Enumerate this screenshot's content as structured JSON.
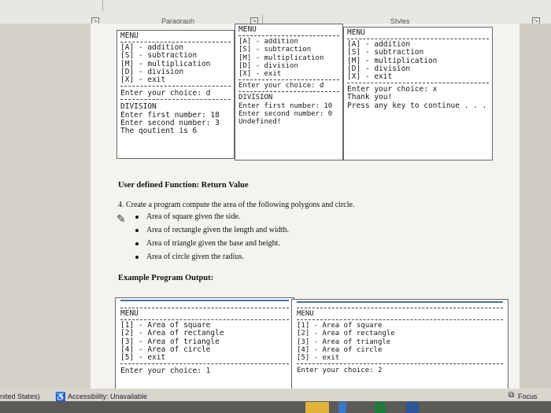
{
  "ribbon": {
    "groups": [
      {
        "label": "Paragraph"
      },
      {
        "label": "Styles"
      }
    ]
  },
  "console1": {
    "menu_title": "MENU",
    "items": [
      "[A] - addition",
      "[S] - subtraction",
      "[M] - multiplication",
      "[D] - division",
      "[X] - exit"
    ],
    "prompt": "Enter your choice: d",
    "output": [
      "DIVISION",
      "Enter first number: 18",
      "Enter second number: 3",
      "The qoutient is 6"
    ]
  },
  "console2": {
    "menu_title": "MENU",
    "items": [
      "[A] - addition",
      "[S] - subtraction",
      "[M] - multiplication",
      "[D] - division",
      "[X] - exit"
    ],
    "prompt": "Enter your choice: d",
    "output": [
      "DIVISION",
      "Enter first number: 10",
      "Enter second number: 0",
      "Undefined!"
    ]
  },
  "console3": {
    "menu_title": "MENU",
    "items": [
      "[A] - addition",
      "[S] - subtraction",
      "[M] - multiplication",
      "[D] - division",
      "[X] - exit"
    ],
    "prompt": "Enter your choice: x",
    "output": [
      "Thank you!",
      "Press any key to continue . . ."
    ]
  },
  "section": {
    "title": "User defined Function: Return Value",
    "task": "4.  Create a program compute the area of the following polygons and circle.",
    "bullets": [
      "Area of square given the side.",
      "Area of rectangle given the length and width.",
      "Area of triangle given the base and height.",
      "Area of circle given the radius."
    ],
    "example_heading": "Example Program Output:"
  },
  "console4": {
    "menu_title": "MENU",
    "items": [
      "[1] - Area of square",
      "[2] - Area of rectangle",
      "[3] - Area of triangle",
      "[4] - Area of circle",
      "[5] - exit"
    ],
    "prompt": "Enter your choice: 1"
  },
  "console5": {
    "menu_title": "MENU",
    "items": [
      "[1] - Area of square",
      "[2] - Area of rectangle",
      "[3] - Area of triangle",
      "[4] - Area of circle",
      "[5] - exit"
    ],
    "prompt": "Enter your choice: 2"
  },
  "statusbar": {
    "language": "nited States)",
    "accessibility": "Accessibility: Unavailable",
    "focus": "Focus"
  }
}
